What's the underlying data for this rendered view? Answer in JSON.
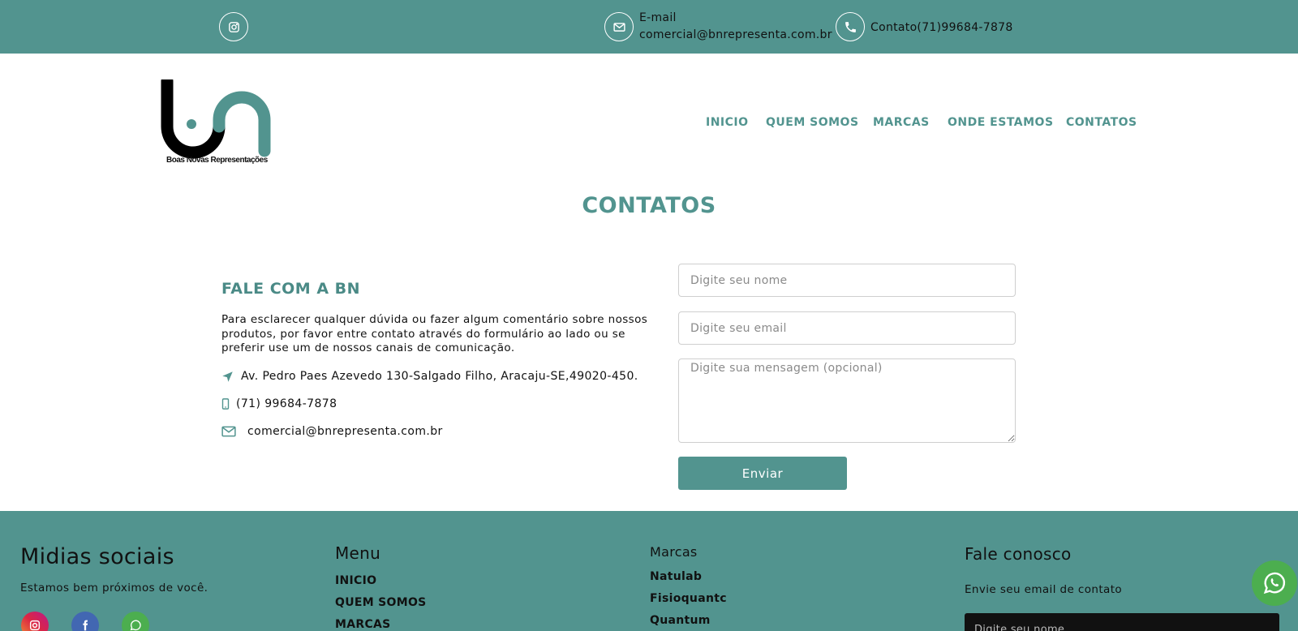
{
  "topbar": {
    "instagram_icon": "instagram-icon",
    "email_label": "E-mail",
    "email_value": "comercial@bnrepresenta.com.br",
    "contact_text": "Contato(71)99684-7878"
  },
  "header": {
    "logo_caption": "Boas Novas Representações",
    "nav": [
      "INICIO",
      "QUEM SOMOS",
      "MARCAS",
      "ONDE ESTAMOS",
      "CONTATOS"
    ]
  },
  "page": {
    "title": "CONTATOS"
  },
  "contact": {
    "heading": "FALE COM A BN",
    "description": "Para esclarecer qualquer dúvida ou fazer algum comentário sobre nossos produtos, por favor entre contato através do formulário ao lado ou se preferir use um de nossos canais de comunicação.",
    "address": "Av. Pedro Paes Azevedo 130-Salgado Filho, Aracaju-SE,49020-450.",
    "phone": "(71) 99684-7878",
    "email": "comercial@bnrepresenta.com.br"
  },
  "form": {
    "name_placeholder": "Digite seu nome",
    "email_placeholder": "Digite seu email",
    "message_placeholder": "Digite sua mensagem (opcional)",
    "submit_label": "Enviar"
  },
  "footer": {
    "social_title": "Midias sociais",
    "social_subtitle": "Estamos bem próximos de você.",
    "menu_title": "Menu",
    "menu_items": [
      "INICIO",
      "QUEM SOMOS",
      "MARCAS"
    ],
    "brands_title": "Marcas",
    "brands": [
      "Natulab",
      "Fisioquantc",
      "Quantum"
    ],
    "contact_title": "Fale conosco",
    "contact_subtitle": "Envie seu email de contato",
    "name_placeholder": "Digite seu nome"
  },
  "colors": {
    "brand_teal": "#52948f",
    "whatsapp_green": "#4cae4f",
    "facebook_blue": "#4267b2"
  }
}
